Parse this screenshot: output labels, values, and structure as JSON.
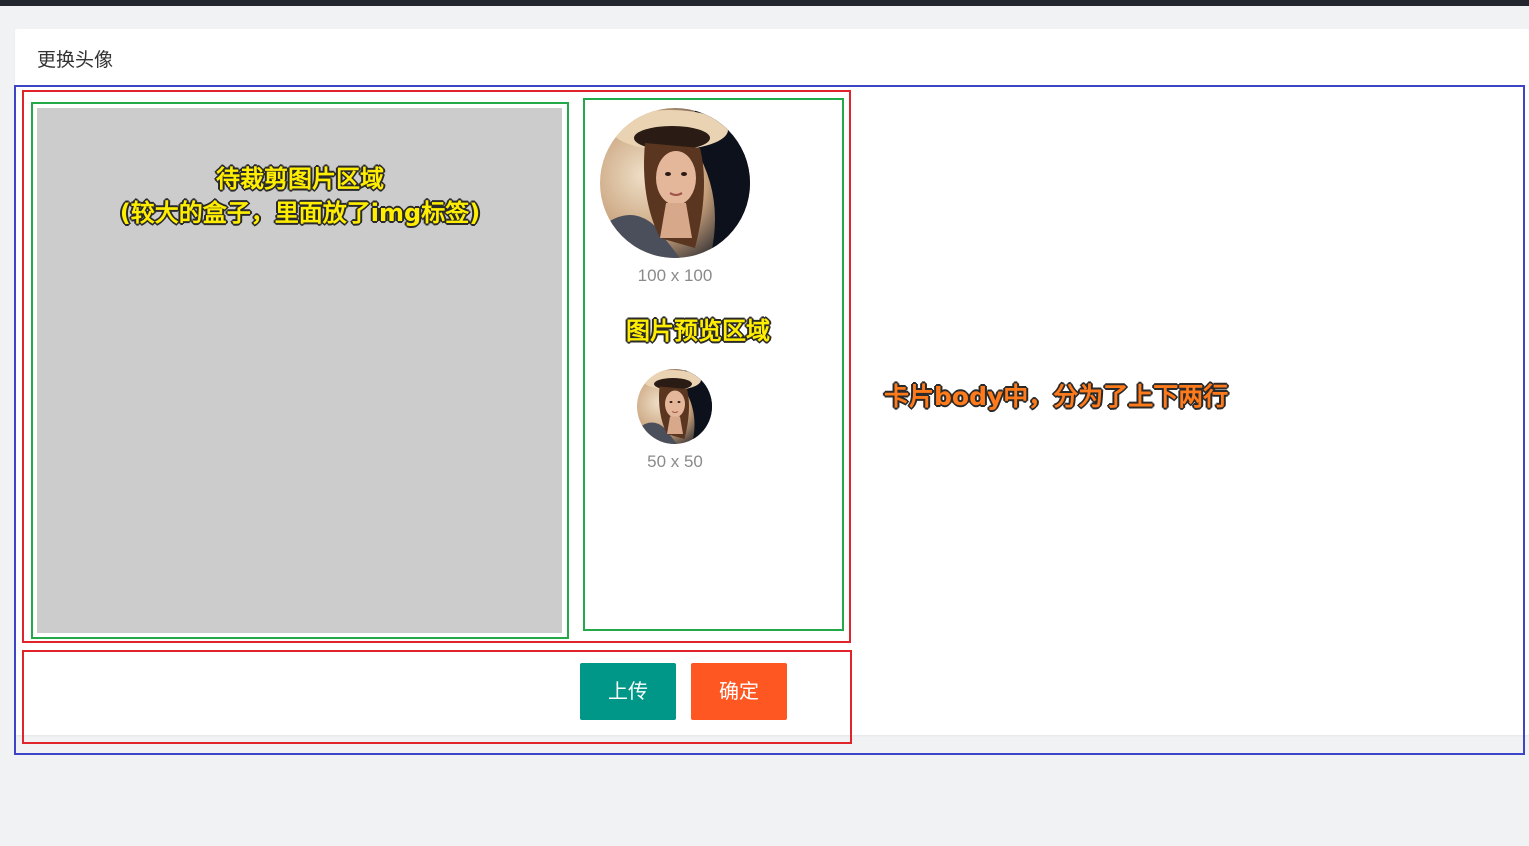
{
  "card": {
    "title": "更换头像"
  },
  "annotations": {
    "crop_line1": "待裁剪图片区域",
    "crop_line2": "(较大的盒子，里面放了img标签)",
    "preview": "图片预览区域",
    "body": "卡片body中，分为了上下两行"
  },
  "previews": {
    "large_label": "100 x 100",
    "small_label": "50 x 50"
  },
  "buttons": {
    "upload": "上传",
    "confirm": "确定"
  },
  "colors": {
    "upload_button": "#009688",
    "confirm_button": "#ff5722",
    "crop_area": "#cccccc",
    "outline_blue": "#3d45c6",
    "outline_red": "#e0242c",
    "outline_green": "#23a84a"
  }
}
